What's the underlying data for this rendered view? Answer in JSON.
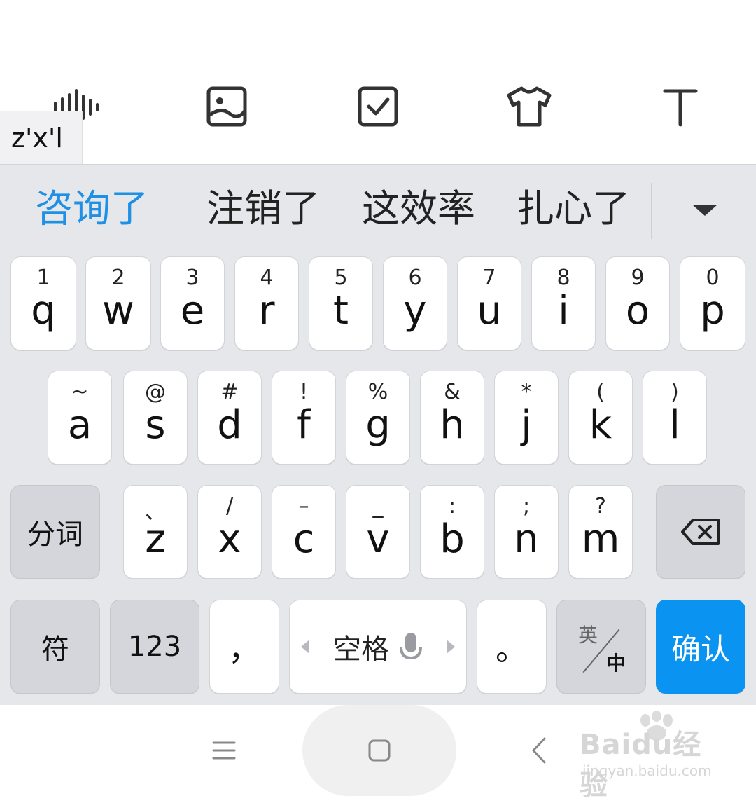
{
  "toolbar": {
    "icons": [
      "voice-waveform-icon",
      "image-icon",
      "checkbox-icon",
      "tshirt-icon",
      "text-icon"
    ]
  },
  "composition": {
    "text": "z'x'l"
  },
  "candidates": {
    "items": [
      "咨询了",
      "注销了",
      "这效率",
      "扎心了"
    ],
    "highlight_color": "#1e90e6"
  },
  "rows": {
    "row1": [
      {
        "hint": "1",
        "key": "q"
      },
      {
        "hint": "2",
        "key": "w"
      },
      {
        "hint": "3",
        "key": "e"
      },
      {
        "hint": "4",
        "key": "r"
      },
      {
        "hint": "5",
        "key": "t"
      },
      {
        "hint": "6",
        "key": "y"
      },
      {
        "hint": "7",
        "key": "u"
      },
      {
        "hint": "8",
        "key": "i"
      },
      {
        "hint": "9",
        "key": "o"
      },
      {
        "hint": "0",
        "key": "p"
      }
    ],
    "row2": [
      {
        "hint": "~",
        "key": "a"
      },
      {
        "hint": "@",
        "key": "s"
      },
      {
        "hint": "#",
        "key": "d"
      },
      {
        "hint": "!",
        "key": "f"
      },
      {
        "hint": "%",
        "key": "g"
      },
      {
        "hint": "&",
        "key": "h"
      },
      {
        "hint": "*",
        "key": "j"
      },
      {
        "hint": "(",
        "key": "k"
      },
      {
        "hint": ")",
        "key": "l"
      }
    ],
    "row3": [
      {
        "hint": "、",
        "key": "z"
      },
      {
        "hint": "/",
        "key": "x"
      },
      {
        "hint": "–",
        "key": "c"
      },
      {
        "hint": "_",
        "key": "v"
      },
      {
        "hint": ":",
        "key": "b"
      },
      {
        "hint": ";",
        "key": "n"
      },
      {
        "hint": "?",
        "key": "m"
      }
    ]
  },
  "keys": {
    "segment": "分词",
    "symbols": "符",
    "numbers": "123",
    "comma": "，",
    "space": "空格",
    "period": "。",
    "lang_top": "英",
    "lang_bottom": "中",
    "confirm": "确认"
  },
  "colors": {
    "accent": "#0a93f0",
    "keyboard_bg": "#e6e7eb",
    "fn_key": "#d5d6db"
  },
  "watermark": {
    "main": "Baidu经验",
    "sub": "jingyan.baidu.com"
  }
}
